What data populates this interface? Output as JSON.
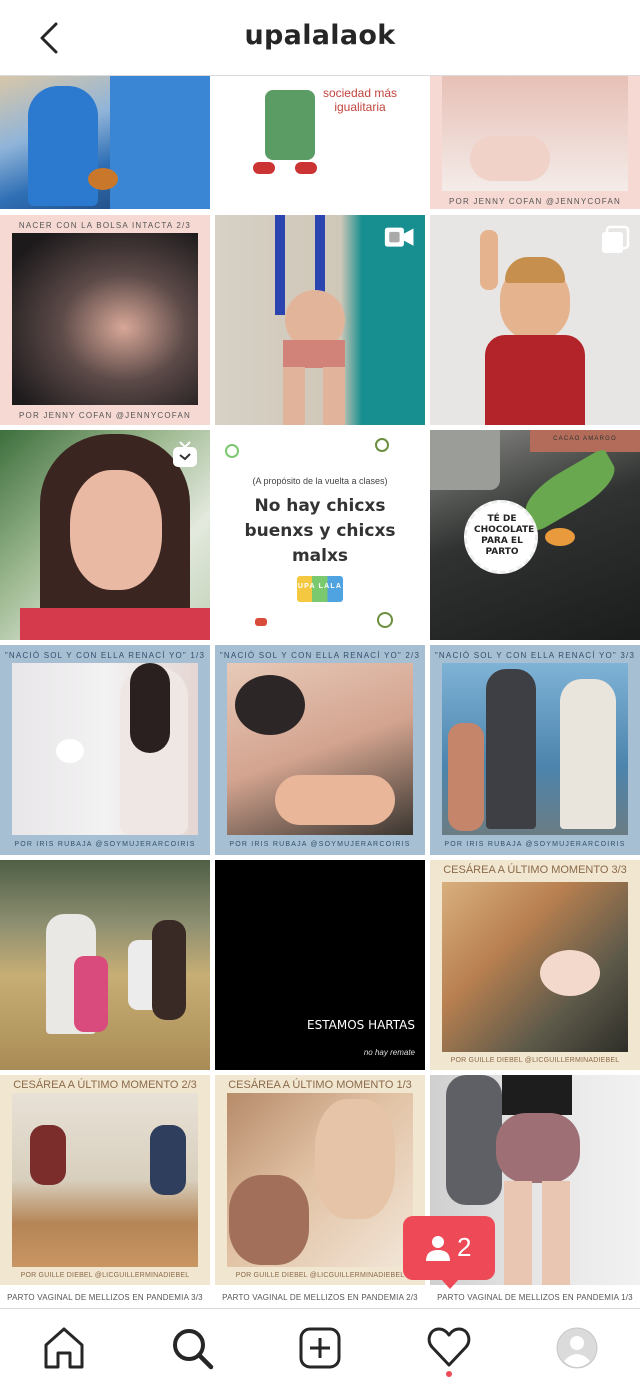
{
  "header": {
    "title": "upalalaok",
    "back_icon": "chevron-left-icon"
  },
  "posts": [
    {
      "caption": "",
      "icon": ""
    },
    {
      "caption_top": "sociedad más igualitaria",
      "icon": ""
    },
    {
      "caption": "POR JENNY COFAN @JENNYCOFAN",
      "icon": ""
    },
    {
      "caption_top": "NACER CON LA BOLSA INTACTA 2/3",
      "caption": "POR JENNY COFAN @JENNYCOFAN",
      "icon": ""
    },
    {
      "caption": "",
      "icon": "video-icon"
    },
    {
      "caption": "",
      "icon": "carousel-icon"
    },
    {
      "caption": "",
      "icon": "igtv-icon"
    },
    {
      "caption_top": "(A propósito de la vuelta a clases)",
      "headline": "No hay chicxs buenxs y chicxs malxs",
      "logo": "UPA LALA",
      "icon": ""
    },
    {
      "badge_text": "TÉ DE CHOCOLATE PARA EL PARTO",
      "label": "CACAO AMARGO",
      "icon": ""
    },
    {
      "caption_top": "\"NACIÓ SOL Y CON ELLA RENACÍ YO\" 1/3",
      "caption": "POR IRIS RUBAJA @SOYMUJERARCOIRIS",
      "icon": ""
    },
    {
      "caption_top": "\"NACIÓ SOL Y CON ELLA RENACÍ YO\" 2/3",
      "caption": "POR IRIS RUBAJA @SOYMUJERARCOIRIS",
      "icon": ""
    },
    {
      "caption_top": "\"NACIÓ SOL Y CON ELLA RENACÍ YO\" 3/3",
      "caption": "POR IRIS RUBAJA @SOYMUJERARCOIRIS",
      "icon": ""
    },
    {
      "caption": "",
      "icon": ""
    },
    {
      "headline": "ESTAMOS HARTAS",
      "caption": "no hay remate",
      "icon": ""
    },
    {
      "caption_top": "CESÁREA A ÚLTIMO MOMENTO 3/3",
      "caption": "POR GUILLE DIEBEL @LICGUILLERMINADIEBEL",
      "icon": ""
    },
    {
      "caption_top": "CESÁREA A ÚLTIMO MOMENTO 2/3",
      "caption": "POR GUILLE DIEBEL @LICGUILLERMINADIEBEL",
      "icon": ""
    },
    {
      "caption_top": "CESÁREA A ÚLTIMO MOMENTO 1/3",
      "caption": "POR GUILLE DIEBEL @LICGUILLERMINADIEBEL",
      "icon": ""
    },
    {
      "caption": "",
      "icon": ""
    }
  ],
  "bottom_captions": [
    "PARTO VAGINAL DE MELLIZOS EN PANDEMIA 3/3",
    "PARTO VAGINAL DE MELLIZOS EN PANDEMIA 2/3",
    "PARTO VAGINAL DE MELLIZOS EN PANDEMIA 1/3"
  ],
  "notification": {
    "icon": "person-icon",
    "count": "2"
  },
  "nav": {
    "items": [
      "home-icon",
      "search-icon",
      "new-post-icon",
      "activity-heart-icon",
      "profile-avatar-icon"
    ],
    "active": "search-icon",
    "notification_dot": true
  },
  "colors": {
    "badge": "#ed4956",
    "border": "#dbdbdb",
    "text": "#262626"
  }
}
